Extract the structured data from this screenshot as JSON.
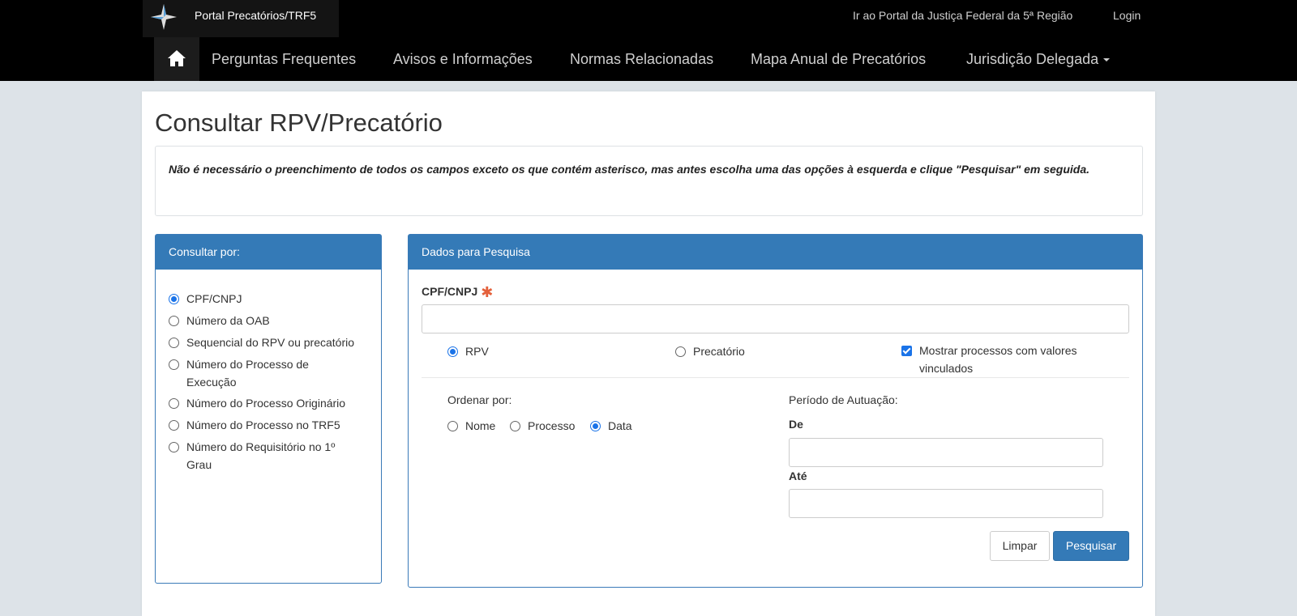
{
  "header": {
    "brand": "Portal Precatórios/TRF5",
    "portal_link": "Ir ao Portal da Justiça Federal da 5ª Região",
    "login": "Login"
  },
  "nav": {
    "home_icon": "home-icon",
    "items": [
      "Perguntas Frequentes",
      "Avisos e Informações",
      "Normas Relacionadas",
      "Mapa Anual de Precatórios",
      "Jurisdição Delegada"
    ]
  },
  "page": {
    "title": "Consultar RPV/Precatório",
    "note": "Não é necessário o preenchimento de todos os campos exceto os que contém asterisco, mas antes escolha uma das opções à esquerda e clique \"Pesquisar\" em seguida."
  },
  "consultar": {
    "heading": "Consultar por:",
    "options": [
      {
        "label": "CPF/CNPJ",
        "checked": true
      },
      {
        "label": "Número da OAB",
        "checked": false
      },
      {
        "label": "Sequencial do RPV ou precatório",
        "checked": false
      },
      {
        "label": "Número do Processo de Execução",
        "checked": false
      },
      {
        "label": "Número do Processo Originário",
        "checked": false
      },
      {
        "label": "Número do Processo no TRF5",
        "checked": false
      },
      {
        "label": "Número do Requisitório no 1º Grau",
        "checked": false
      }
    ]
  },
  "dados": {
    "heading": "Dados para Pesquisa",
    "cpf_label": "CPF/CNPJ",
    "cpf_value": "",
    "tipo": [
      {
        "label": "RPV",
        "checked": true
      },
      {
        "label": "Precatório",
        "checked": false
      }
    ],
    "mostrar_label": "Mostrar processos com valores vinculados",
    "mostrar_checked": true,
    "ordenar_label": "Ordenar por:",
    "ordenar": [
      {
        "label": "Nome",
        "checked": false
      },
      {
        "label": "Processo",
        "checked": false
      },
      {
        "label": "Data",
        "checked": true
      }
    ],
    "periodo_label": "Período de Autuação:",
    "de_label": "De",
    "de_value": "",
    "ate_label": "Até",
    "ate_value": "",
    "limpar": "Limpar",
    "pesquisar": "Pesquisar"
  },
  "colors": {
    "topbar": "#000000",
    "panel_header": "#347ab7",
    "page_bg": "#dde3e8",
    "asterisk": "#e4603b"
  }
}
